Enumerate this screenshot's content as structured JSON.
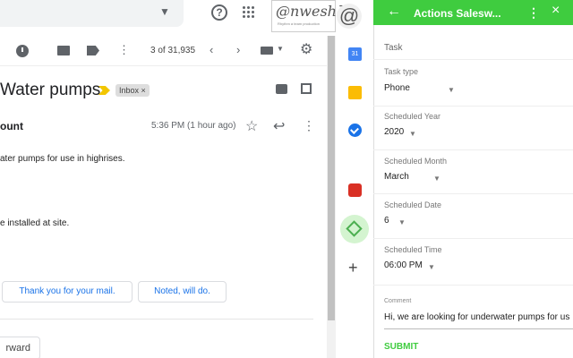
{
  "header": {
    "brand_text": "@nweshā",
    "brand_sub": "Rhythm a team production",
    "brand_at": "@"
  },
  "toolbar": {
    "counter": "3 of 31,935"
  },
  "message": {
    "subject": "Water pumps",
    "label": "Inbox ×",
    "sender": "ount",
    "time": "5:36 PM (1 hour ago)",
    "line1": "ater pumps for use in highrises.",
    "line2": "e installed at site.",
    "smart_replies": [
      "Thank you for your mail.",
      "Noted, will do."
    ],
    "forward_label": "rward"
  },
  "side_apps": {
    "calendar_day": "31"
  },
  "panel": {
    "title": "Actions Salesw...",
    "section": "Task",
    "fields": [
      {
        "label": "Task type",
        "value": "Phone"
      },
      {
        "label": "Scheduled Year",
        "value": "2020"
      },
      {
        "label": "Scheduled Month",
        "value": "March"
      },
      {
        "label": "Scheduled Date",
        "value": "6"
      },
      {
        "label": "Scheduled Time",
        "value": "06:00 PM"
      }
    ],
    "comment_label": "Comment",
    "comment_value": "Hi, we are looking for underwater pumps for us",
    "submit_label": "SUBMIT"
  },
  "colors": {
    "panel_accent": "#3fcc3f",
    "link_blue": "#1a73e8",
    "importance": "#f2c600"
  }
}
